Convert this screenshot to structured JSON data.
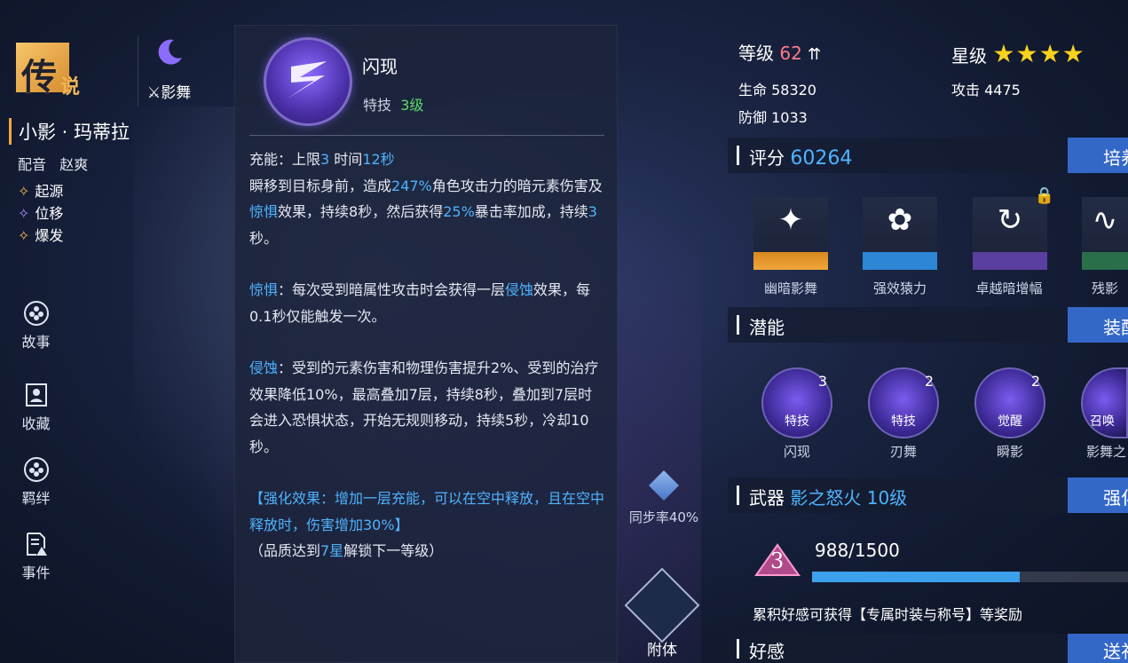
{
  "left": {
    "rarity_main": "传",
    "rarity_sub": "说",
    "element": "影舞",
    "character_name": "小影 · 玛蒂拉",
    "cv_label": "配音",
    "cv_name": "赵爽",
    "tags": [
      "起源",
      "位移",
      "爆发"
    ],
    "nav": [
      "故事",
      "收藏",
      "羁绊",
      "事件"
    ]
  },
  "skill": {
    "name": "闪现",
    "type": "特技",
    "level": "3级",
    "charge": {
      "label": "充能：上限",
      "limit": "3",
      "time_label": "时间",
      "time": "12秒"
    },
    "p1": {
      "a": "瞬移到目标身前，造成",
      "b": "247%",
      "c": "角色攻击力的暗元素伤害及",
      "d": "惊惧",
      "e": "效果，持续8秒，然后获得",
      "f": "25%",
      "g": "暴击率加成，持续",
      "h": "3",
      "i": "秒。"
    },
    "p2": {
      "a": "惊惧",
      "b": "：每次受到暗属性攻击时会获得一层",
      "c": "侵蚀",
      "d": "效果，每0.1秒仅能触发一次。"
    },
    "p3": {
      "a": "侵蚀",
      "b": "：受到的元素伤害和物理伤害提升2%、受到的治疗效果降低10%，最高叠加7层，持续8秒，叠加到7层时会进入恐惧状态，开始无规则移动，持续5秒，冷却10秒。"
    },
    "enhance": "【强化效果：增加一层充能，可以在空中释放，且在空中释放时，伤害增加30%】",
    "unlock": {
      "a": "（品质达到",
      "b": "7星",
      "c": "解锁下一等级）"
    }
  },
  "center": {
    "sync_label": "同步率40%",
    "attach_label": "附体"
  },
  "right": {
    "level_label": "等级",
    "level": "62",
    "star_label": "星级",
    "stars": 4,
    "hp": "生命 58320",
    "atk": "攻击 4475",
    "def": "防御 1033",
    "score_label": "评分",
    "score": "60264",
    "score_btn": "培养",
    "cards": [
      "幽暗影舞",
      "强效猿力",
      "卓越暗增幅",
      "残影"
    ],
    "potential_label": "潜能",
    "potential_btn": "装配",
    "potentials": [
      {
        "tag": "特技",
        "level": "3",
        "name": "闪现"
      },
      {
        "tag": "特技",
        "level": "2",
        "name": "刃舞"
      },
      {
        "tag": "觉醒",
        "level": "2",
        "name": "瞬影"
      },
      {
        "tag": "召唤",
        "level": "",
        "name": "影舞之"
      }
    ],
    "weapon_label": "武器",
    "weapon_name": "影之怒火",
    "weapon_level": "10级",
    "weapon_btn": "强化",
    "affinity_rank": "3",
    "affinity_progress": "988/1500",
    "affinity_fraction": 0.658,
    "affinity_note": "累积好感可获得【专属时装与称号】等奖励",
    "favor_label": "好感",
    "favor_btn": "送礼"
  },
  "colors": {
    "accent": "#4fb3ff",
    "button": "#3468c8",
    "gold": "#f0b556",
    "star": "#f8d21e"
  }
}
